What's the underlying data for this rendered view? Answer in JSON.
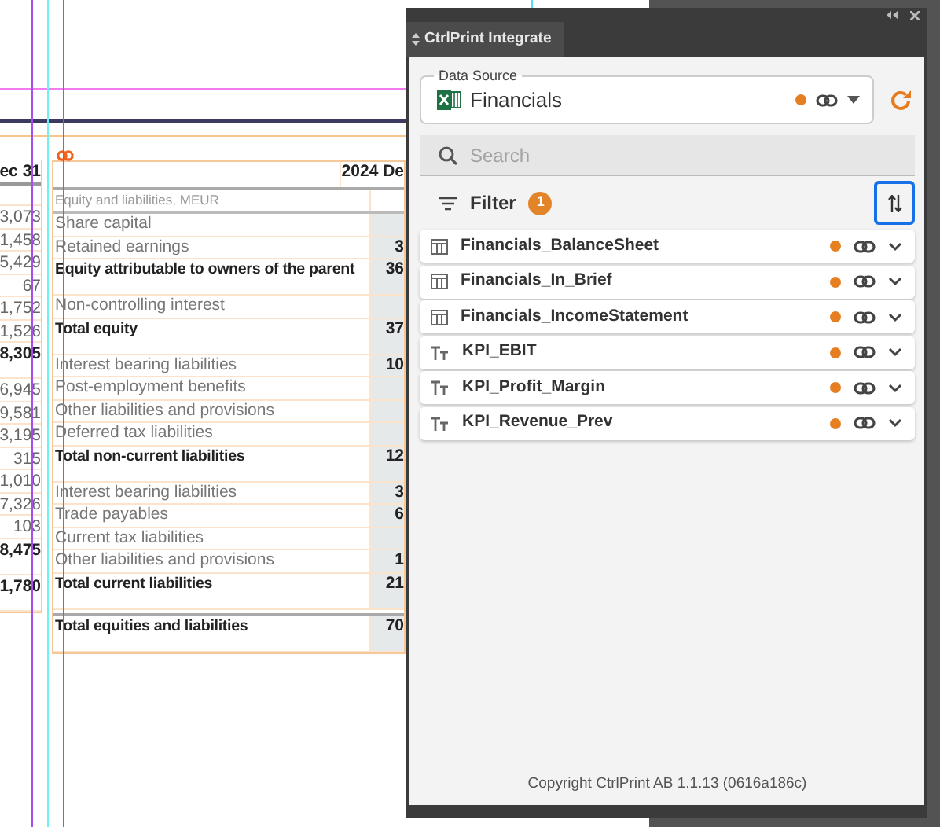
{
  "document": {
    "left_table": {
      "header": "ec 31",
      "rows": [
        {
          "value": "3,073",
          "total": false
        },
        {
          "value": "1,458",
          "total": false
        },
        {
          "value": "5,429",
          "total": false
        },
        {
          "value": "67",
          "total": false
        },
        {
          "value": "1,752",
          "total": false
        },
        {
          "value": "1,526",
          "total": false
        },
        {
          "value": "8,305",
          "total": true
        },
        {
          "value": "6,945",
          "total": false
        },
        {
          "value": "9,581",
          "total": false
        },
        {
          "value": "3,195",
          "total": false
        },
        {
          "value": "315",
          "total": false
        },
        {
          "value": "1,010",
          "total": false
        },
        {
          "value": "7,326",
          "total": false
        },
        {
          "value": "103",
          "total": false
        },
        {
          "value": "8,475",
          "total": true
        },
        {
          "value": "1,780",
          "total": true
        }
      ]
    },
    "right_table": {
      "header": "2024 De",
      "subheader": "Equity and liabilities, MEUR",
      "rows": [
        {
          "label": "Share capital",
          "value": "",
          "total": false
        },
        {
          "label": "Retained earnings",
          "value": "3",
          "total": false
        },
        {
          "label": "Equity attributable to owners of the parent",
          "value": "36",
          "total": true
        },
        {
          "label": "Non-controlling interest",
          "value": "",
          "total": false
        },
        {
          "label": "Total equity",
          "value": "37",
          "total": true
        },
        {
          "label": "Interest bearing liabilities",
          "value": "10",
          "total": false
        },
        {
          "label": "Post-employment benefits",
          "value": "",
          "total": false
        },
        {
          "label": "Other liabilities  and provisions",
          "value": "",
          "total": false
        },
        {
          "label": "Deferred tax liabilities",
          "value": "",
          "total": false
        },
        {
          "label": "Total non-current liabilities",
          "value": "12",
          "total": true
        },
        {
          "label": "Interest bearing liabilities",
          "value": "3",
          "total": false
        },
        {
          "label": "Trade payables",
          "value": "6",
          "total": false
        },
        {
          "label": "Current tax liabilities",
          "value": "",
          "total": false
        },
        {
          "label": "Other liabilities and provisions",
          "value": "1",
          "total": false
        },
        {
          "label": "Total current liabilities",
          "value": "21",
          "total": true
        },
        {
          "label": "Total equities and liabilities",
          "value": "70",
          "total": true
        }
      ]
    }
  },
  "panel": {
    "tab": "CtrlPrint Integrate",
    "data_source": {
      "legend": "Data Source",
      "value": "Financials"
    },
    "search": {
      "placeholder": "Search"
    },
    "filter": {
      "label": "Filter",
      "count": "1"
    },
    "sort_button": {
      "focused": true
    },
    "items": [
      {
        "kind": "table",
        "name": "Financials_BalanceSheet"
      },
      {
        "kind": "table",
        "name": "Financials_In_Brief"
      },
      {
        "kind": "table",
        "name": "Financials_IncomeStatement"
      },
      {
        "kind": "text",
        "name": "KPI_EBIT"
      },
      {
        "kind": "text",
        "name": "KPI_Profit_Margin"
      },
      {
        "kind": "text",
        "name": "KPI_Revenue_Prev"
      }
    ],
    "footer": "Copyright CtrlPrint AB 1.1.13 (0616a186c)"
  }
}
